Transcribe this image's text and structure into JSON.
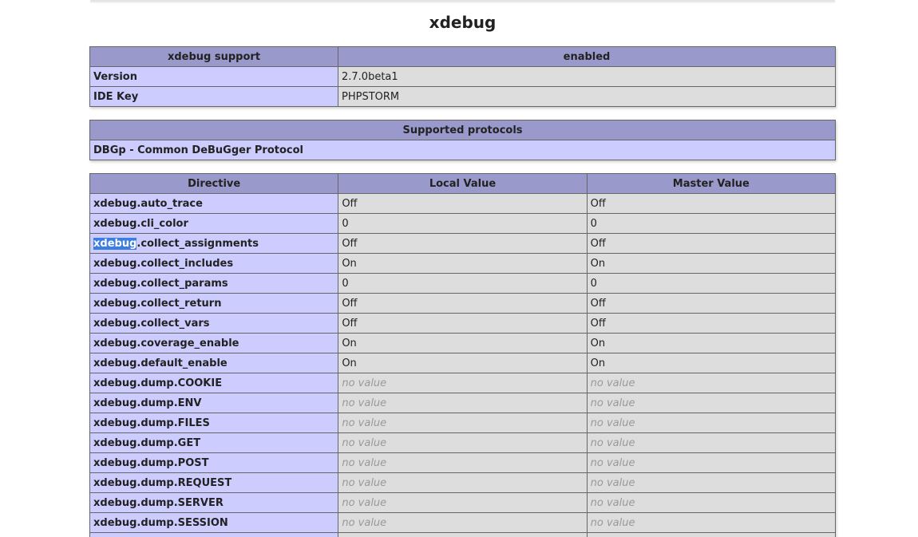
{
  "section_title": "xdebug",
  "support_table": {
    "header": [
      "xdebug support",
      "enabled"
    ],
    "rows": [
      {
        "name": "Version",
        "value": "2.7.0beta1"
      },
      {
        "name": "IDE Key",
        "value": "PHPSTORM"
      }
    ]
  },
  "protocols_table": {
    "header": "Supported protocols",
    "rows": [
      "DBGp - Common DeBuGger Protocol"
    ]
  },
  "directives_table": {
    "headers": [
      "Directive",
      "Local Value",
      "Master Value"
    ],
    "rows": [
      {
        "prefix": "",
        "name": "xdebug.auto_trace",
        "local": "Off",
        "master": "Off"
      },
      {
        "prefix": "",
        "name": "xdebug.cli_color",
        "local": "0",
        "master": "0"
      },
      {
        "prefix": "xdebug",
        "name": ".collect_assignments",
        "local": "Off",
        "master": "Off"
      },
      {
        "prefix": "",
        "name": "xdebug.collect_includes",
        "local": "On",
        "master": "On"
      },
      {
        "prefix": "",
        "name": "xdebug.collect_params",
        "local": "0",
        "master": "0"
      },
      {
        "prefix": "",
        "name": "xdebug.collect_return",
        "local": "Off",
        "master": "Off"
      },
      {
        "prefix": "",
        "name": "xdebug.collect_vars",
        "local": "Off",
        "master": "Off"
      },
      {
        "prefix": "",
        "name": "xdebug.coverage_enable",
        "local": "On",
        "master": "On"
      },
      {
        "prefix": "",
        "name": "xdebug.default_enable",
        "local": "On",
        "master": "On"
      },
      {
        "prefix": "",
        "name": "xdebug.dump.COOKIE",
        "local": "no value",
        "master": "no value",
        "empty": true
      },
      {
        "prefix": "",
        "name": "xdebug.dump.ENV",
        "local": "no value",
        "master": "no value",
        "empty": true
      },
      {
        "prefix": "",
        "name": "xdebug.dump.FILES",
        "local": "no value",
        "master": "no value",
        "empty": true
      },
      {
        "prefix": "",
        "name": "xdebug.dump.GET",
        "local": "no value",
        "master": "no value",
        "empty": true
      },
      {
        "prefix": "",
        "name": "xdebug.dump.POST",
        "local": "no value",
        "master": "no value",
        "empty": true
      },
      {
        "prefix": "",
        "name": "xdebug.dump.REQUEST",
        "local": "no value",
        "master": "no value",
        "empty": true
      },
      {
        "prefix": "",
        "name": "xdebug.dump.SERVER",
        "local": "no value",
        "master": "no value",
        "empty": true
      },
      {
        "prefix": "",
        "name": "xdebug.dump.SESSION",
        "local": "no value",
        "master": "no value",
        "empty": true
      },
      {
        "prefix": "",
        "name": "",
        "local": "",
        "master": ""
      }
    ]
  }
}
